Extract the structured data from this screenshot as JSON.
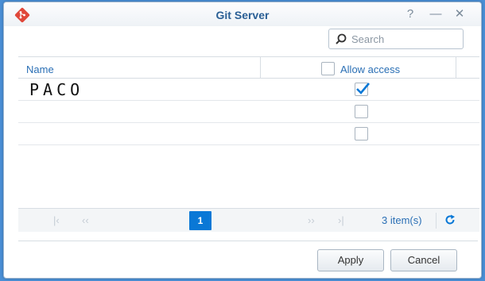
{
  "window": {
    "title": "Git Server",
    "help_symbol": "?",
    "minimize_symbol": "—",
    "close_symbol": "✕"
  },
  "search": {
    "placeholder": "Search",
    "value": ""
  },
  "grid": {
    "columns": {
      "name": "Name",
      "allow_access": "Allow access"
    },
    "select_all_checked": false,
    "rows": [
      {
        "name": "PACO",
        "allow_access": true
      },
      {
        "name": "",
        "allow_access": false
      },
      {
        "name": "",
        "allow_access": false
      }
    ]
  },
  "pager": {
    "first_symbol": "|‹",
    "prev_symbol": "‹‹",
    "current_page": "1",
    "next_symbol": "››",
    "last_symbol": "›|",
    "item_count": "3 item(s)"
  },
  "buttons": {
    "apply": "Apply",
    "cancel": "Cancel"
  },
  "colors": {
    "accent": "#0a78d6",
    "title": "#2a5f95",
    "icon_red": "#e0483a"
  }
}
